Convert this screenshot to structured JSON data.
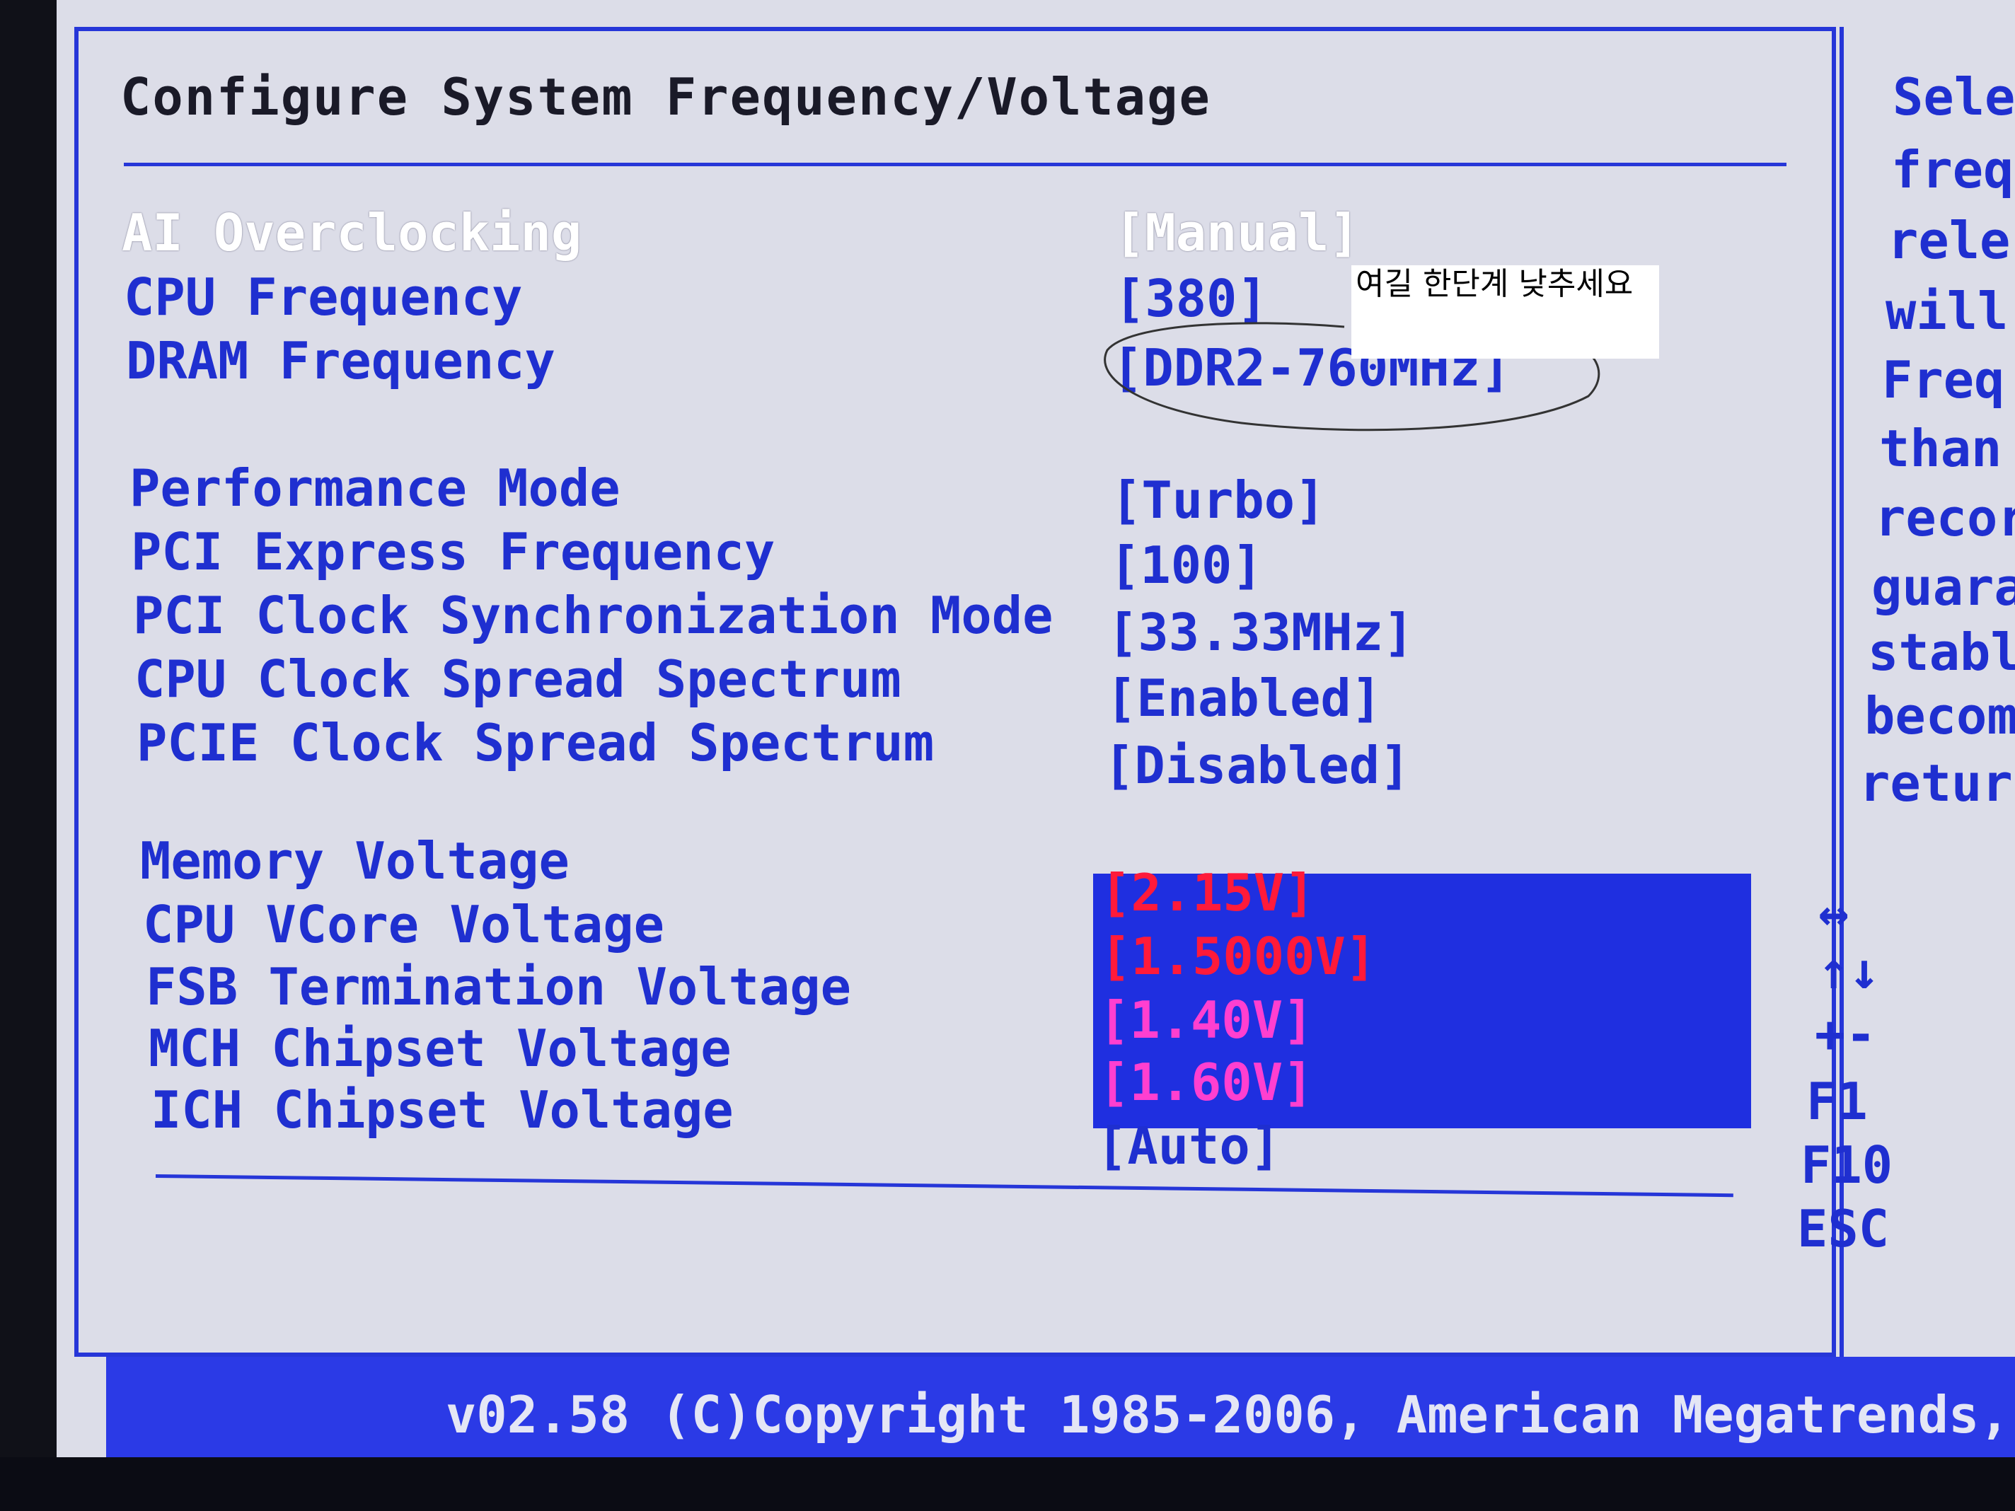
{
  "title": "Configure System Frequency/Voltage",
  "settings": [
    {
      "label": "AI Overclocking",
      "value": "[Manual]"
    },
    {
      "label": "CPU Frequency",
      "value": "[380]"
    },
    {
      "label": "DRAM Frequency",
      "value": "[DDR2-760MHz]"
    },
    {
      "label": "Performance Mode",
      "value": "[Turbo]"
    },
    {
      "label": "PCI Express Frequency",
      "value": "[100]"
    },
    {
      "label": "PCI Clock Synchronization Mode",
      "value": "[33.33MHz]"
    },
    {
      "label": "CPU Clock Spread Spectrum",
      "value": "[Enabled]"
    },
    {
      "label": "PCIE Clock Spread Spectrum",
      "value": "[Disabled]"
    },
    {
      "label": "Memory Voltage",
      "value": "[2.15V]"
    },
    {
      "label": "CPU VCore Voltage",
      "value": "[1.5000V]"
    },
    {
      "label": "FSB Termination Voltage",
      "value": "[1.40V]"
    },
    {
      "label": "MCH Chipset Voltage",
      "value": "[1.60V]"
    },
    {
      "label": "ICH Chipset Voltage",
      "value": "[Auto]"
    }
  ],
  "annotation_note": "여길 한단계 낮추세요",
  "help_lines": [
    "Sele",
    "freq",
    "rele",
    "will",
    "Freq",
    "than",
    "recor",
    "guara",
    "stabl",
    "becom",
    "retur"
  ],
  "nav_keys": [
    "↔",
    "↑↓",
    "+-",
    "F1",
    "F10",
    "ESC"
  ],
  "footer": "v02.58 (C)Copyright 1985-2006, American Megatrends,",
  "colors": {
    "screen_bg": "#dcdde8",
    "accent_blue": "#1f2fd0",
    "highlight_bg": "#1f2fe0",
    "value_red": "#ff1a3a",
    "value_pink": "#ff3fd0"
  }
}
